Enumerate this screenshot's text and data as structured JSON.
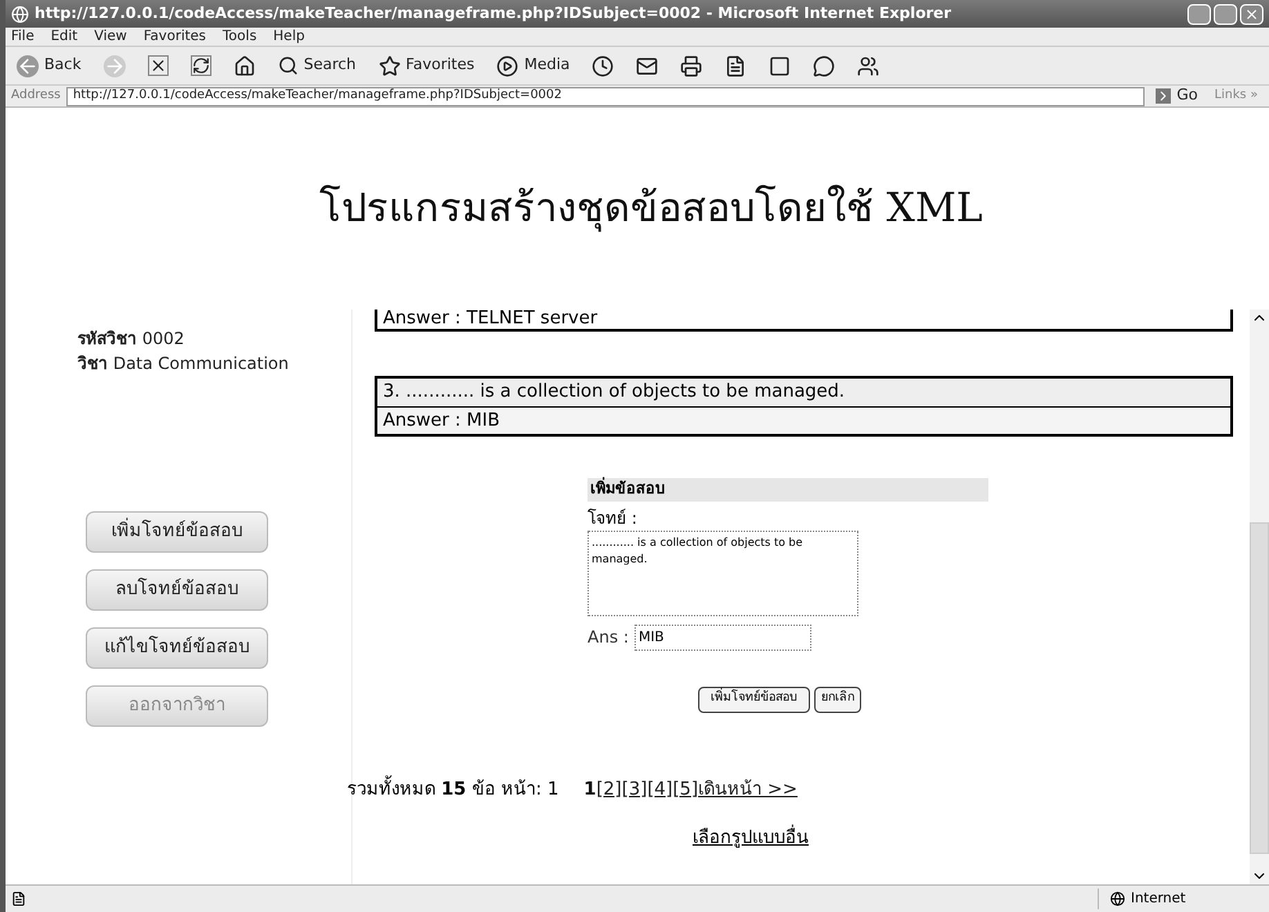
{
  "window": {
    "title": "http://127.0.0.1/codeAccess/makeTeacher/manageframe.php?IDSubject=0002 - Microsoft Internet Explorer"
  },
  "menu": [
    "File",
    "Edit",
    "View",
    "Favorites",
    "Tools",
    "Help"
  ],
  "toolbar": {
    "back": "Back",
    "search": "Search",
    "favorites": "Favorites",
    "media": "Media"
  },
  "address": {
    "label": "Address",
    "url": "http://127.0.0.1/codeAccess/makeTeacher/manageframe.php?IDSubject=0002",
    "go": "Go",
    "links": "Links »"
  },
  "page": {
    "title": "โปรแกรมสร้างชุดข้อสอบโดยใช้ XML",
    "subject": [
      {
        "label": "รหัสวิชา",
        "value": "0002"
      },
      {
        "label": "วิชา",
        "value": "Data Communication"
      }
    ],
    "actions": [
      {
        "label": "เพิ่มโจทย์ข้อสอบ",
        "disabled": false
      },
      {
        "label": "ลบโจทย์ข้อสอบ",
        "disabled": false
      },
      {
        "label": "แก้ไขโจทย์ข้อสอบ",
        "disabled": false
      },
      {
        "label": "ออกจากวิชา",
        "disabled": true
      }
    ]
  },
  "frame": {
    "prev_answer": "Answer : TELNET server",
    "question": {
      "text": "3. ............ is a collection of objects to be managed.",
      "answer": "Answer : MIB"
    },
    "form": {
      "heading": "เพิ่มข้อสอบ",
      "question_label": "โจทย์ :",
      "question_value": "............ is a collection of objects to be managed.",
      "answer_label": "Ans :",
      "answer_value": "MIB",
      "submit": "เพิ่มโจทย์ข้อสอบ",
      "cancel": "ยกเลิก"
    },
    "pagination": {
      "summary": "รวมทั้งหมด **15** ข้อ  หน้า: 1",
      "pages": [
        {
          "label": "1",
          "selected": true
        },
        {
          "label": "[2]",
          "selected": false
        },
        {
          "label": "[3]",
          "selected": false
        },
        {
          "label": "[4]",
          "selected": false
        },
        {
          "label": "[5]",
          "selected": false
        }
      ],
      "next": "เดินหน้า >>"
    },
    "other_format": "เลือกรูปแบบอื่น"
  },
  "status_bar": {
    "zone": "Internet"
  }
}
